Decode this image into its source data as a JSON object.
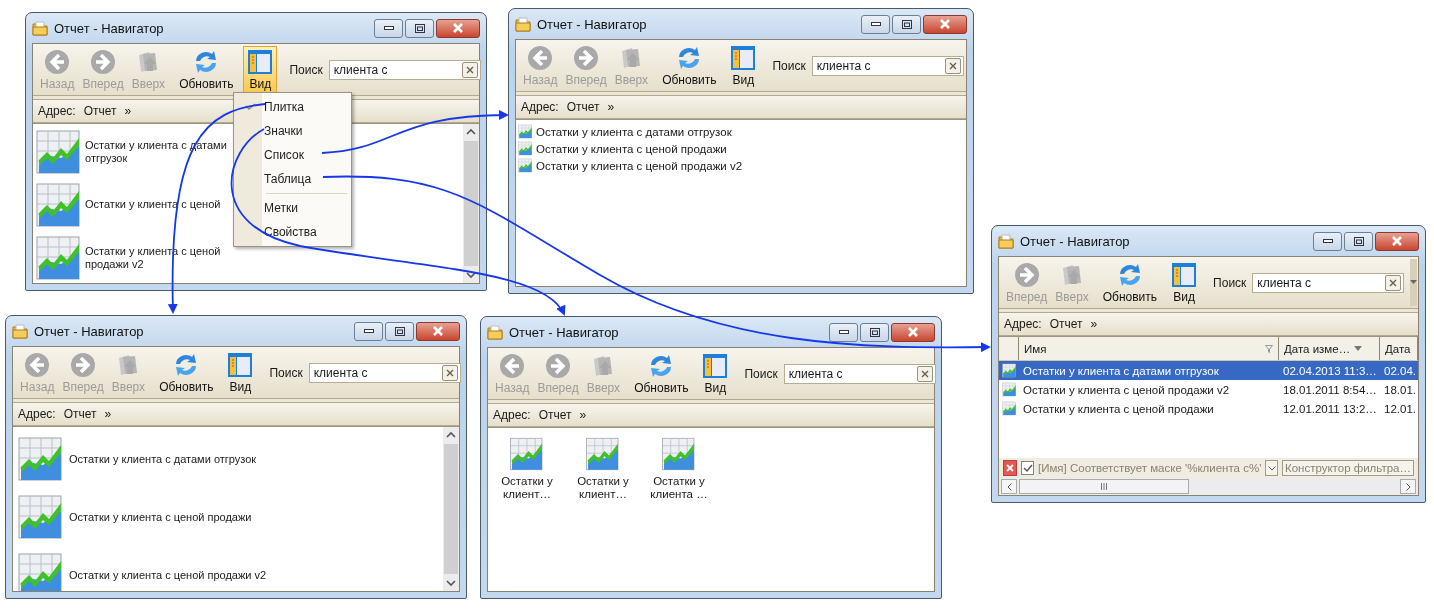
{
  "windows": [
    {
      "title": "Отчет - Навигатор",
      "kind": "tiles",
      "toolbar": [
        {
          "kind": "back",
          "label": "Назад",
          "disabled": true,
          "selected": false
        },
        {
          "kind": "forward",
          "label": "Вперед",
          "disabled": true,
          "selected": false
        },
        {
          "kind": "up",
          "label": "Вверх",
          "disabled": true,
          "selected": false
        },
        {
          "kind": "refresh",
          "label": "Обновить",
          "disabled": false,
          "selected": false
        },
        {
          "kind": "view",
          "label": "Вид",
          "disabled": false,
          "selected": true
        }
      ],
      "search": {
        "label": "Поиск",
        "value": "клиента с"
      },
      "address": {
        "label": "Адрес:",
        "path": "Отчет",
        "more": "»"
      },
      "items": [
        {
          "name": "Остатки у клиента с датами отгрузок"
        },
        {
          "name": "Остатки у клиента с ценой"
        },
        {
          "name": "Остатки у клиента с ценой продажи v2"
        }
      ],
      "menu": [
        {
          "label": "Плитка",
          "checked": true
        },
        {
          "label": "Значки",
          "checked": false
        },
        {
          "label": "Список",
          "checked": false
        },
        {
          "label": "Таблица",
          "checked": false
        },
        {
          "kind": "separator"
        },
        {
          "label": "Метки",
          "checked": false
        },
        {
          "label": "Свойства",
          "checked": false
        }
      ]
    },
    {
      "title": "Отчет - Навигатор",
      "kind": "list",
      "toolbar": [
        {
          "kind": "back",
          "label": "Назад",
          "disabled": true,
          "selected": false
        },
        {
          "kind": "forward",
          "label": "Вперед",
          "disabled": true,
          "selected": false
        },
        {
          "kind": "up",
          "label": "Вверх",
          "disabled": true,
          "selected": false
        },
        {
          "kind": "refresh",
          "label": "Обновить",
          "disabled": false,
          "selected": false
        },
        {
          "kind": "view",
          "label": "Вид",
          "disabled": false,
          "selected": false
        }
      ],
      "search": {
        "label": "Поиск",
        "value": "клиента с"
      },
      "address": {
        "label": "Адрес:",
        "path": "Отчет",
        "more": "»"
      },
      "items": [
        {
          "name": "Остатки у клиента с датами отгрузок"
        },
        {
          "name": "Остатки у клиента с ценой продажи"
        },
        {
          "name": "Остатки у клиента с ценой продажи v2"
        }
      ]
    },
    {
      "title": "Отчет - Навигатор",
      "kind": "tiles",
      "toolbar": [
        {
          "kind": "back",
          "label": "Назад",
          "disabled": true,
          "selected": false
        },
        {
          "kind": "forward",
          "label": "Вперед",
          "disabled": true,
          "selected": false
        },
        {
          "kind": "up",
          "label": "Вверх",
          "disabled": true,
          "selected": false
        },
        {
          "kind": "refresh",
          "label": "Обновить",
          "disabled": false,
          "selected": false
        },
        {
          "kind": "view",
          "label": "Вид",
          "disabled": false,
          "selected": false
        }
      ],
      "search": {
        "label": "Поиск",
        "value": "клиента с"
      },
      "address": {
        "label": "Адрес:",
        "path": "Отчет",
        "more": "»"
      },
      "items": [
        {
          "name": "Остатки у клиента с датами отгрузок"
        },
        {
          "name": "Остатки у клиента с ценой продажи"
        },
        {
          "name": "Остатки у клиента с ценой продажи v2"
        }
      ]
    },
    {
      "title": "Отчет - Навигатор",
      "kind": "icons",
      "toolbar": [
        {
          "kind": "back",
          "label": "Назад",
          "disabled": true,
          "selected": false
        },
        {
          "kind": "forward",
          "label": "Вперед",
          "disabled": true,
          "selected": false
        },
        {
          "kind": "up",
          "label": "Вверх",
          "disabled": true,
          "selected": false
        },
        {
          "kind": "refresh",
          "label": "Обновить",
          "disabled": false,
          "selected": false
        },
        {
          "kind": "view",
          "label": "Вид",
          "disabled": false,
          "selected": false
        }
      ],
      "search": {
        "label": "Поиск",
        "value": "клиента с"
      },
      "address": {
        "label": "Адрес:",
        "path": "Отчет",
        "more": "»"
      },
      "items": [
        {
          "name": "Остатки у клиент…"
        },
        {
          "name": "Остатки у клиент…"
        },
        {
          "name": "Остатки у клиента …"
        }
      ]
    },
    {
      "title": "Отчет - Навигатор",
      "kind": "table",
      "toolbar_overflow": true,
      "toolbar": [
        {
          "kind": "forward",
          "label": "Вперед",
          "disabled": true,
          "selected": false
        },
        {
          "kind": "up",
          "label": "Вверх",
          "disabled": true,
          "selected": false
        },
        {
          "kind": "refresh",
          "label": "Обновить",
          "disabled": false,
          "selected": false
        },
        {
          "kind": "view",
          "label": "Вид",
          "disabled": false,
          "selected": false
        }
      ],
      "search": {
        "label": "Поиск",
        "value": "клиента с"
      },
      "address": {
        "label": "Адрес:",
        "path": "Отчет",
        "more": "»"
      },
      "columns": [
        {
          "label": "Имя",
          "filter_icon": true,
          "sorted": false
        },
        {
          "label": "Дата изме…",
          "filter_icon": false,
          "sorted": true
        },
        {
          "label": "Дата"
        }
      ],
      "rows": [
        {
          "cells": [
            "Остатки у клиента с датами отгрузок",
            "02.04.2013 11:3…",
            "02.04."
          ],
          "selected": true
        },
        {
          "cells": [
            "Остатки у клиента с ценой продажи v2",
            "18.01.2011 8:54…",
            "18.01."
          ],
          "selected": false
        },
        {
          "cells": [
            "Остатки у клиента с ценой продажи",
            "12.01.2011 13:2…",
            "12.01."
          ],
          "selected": false
        }
      ],
      "filter": {
        "checked": true,
        "text": "[Имя] Соответствует маске '%клиента с%'",
        "button": "Конструктор фильтра…"
      }
    }
  ]
}
